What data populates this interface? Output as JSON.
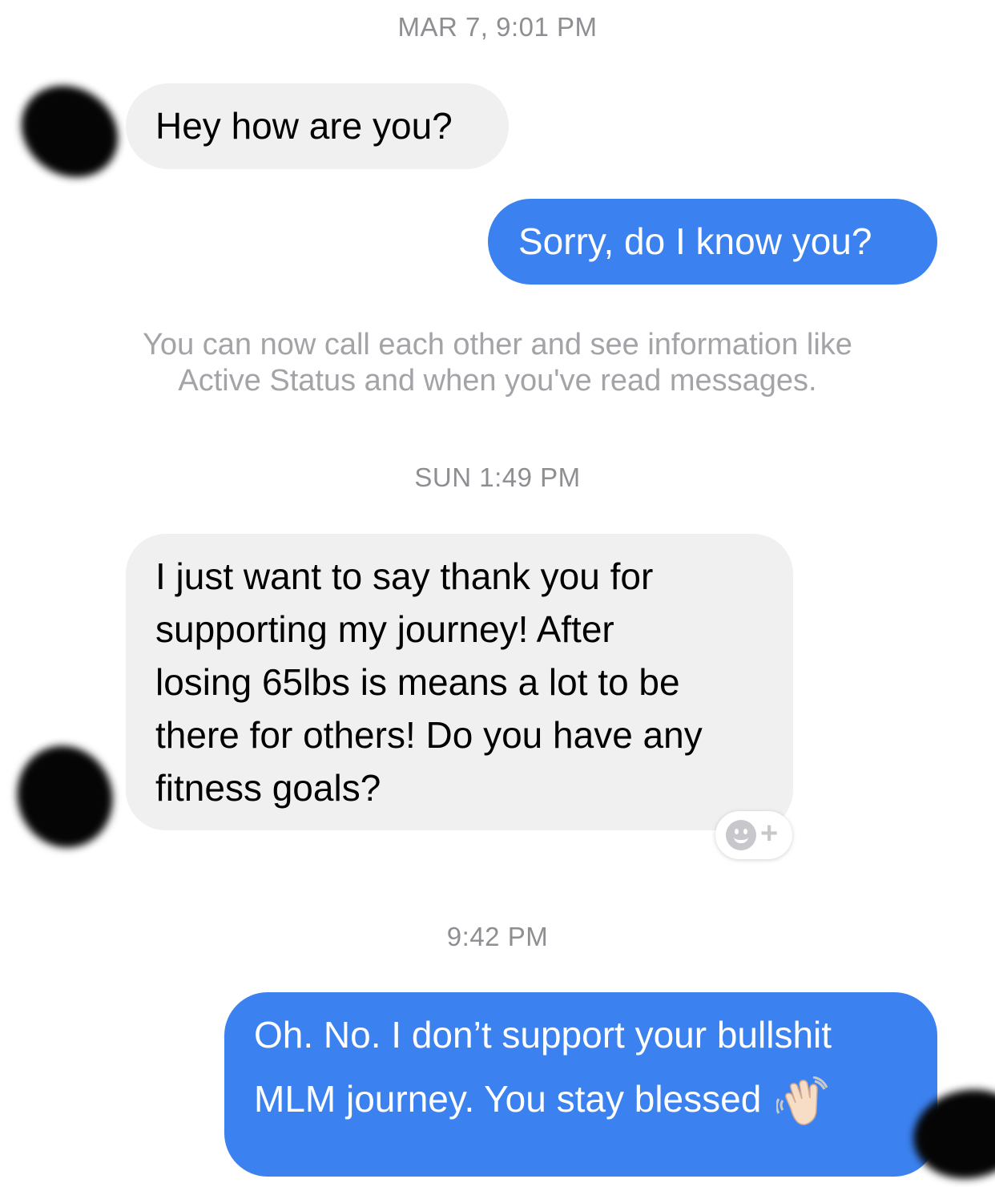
{
  "conversation": {
    "timestamps": {
      "first": "MAR 7, 9:01 PM",
      "second": "SUN 1:49 PM",
      "third": "9:42 PM"
    },
    "messages": [
      {
        "sender": "them",
        "text": "Hey how are you?"
      },
      {
        "sender": "me",
        "text": "Sorry, do I know you?"
      },
      {
        "sender": "them",
        "lines": [
          "I just want to say thank you for",
          "supporting my journey! After",
          "losing 65lbs is means a lot to be",
          "there for others! Do you have any",
          "fitness goals?"
        ]
      },
      {
        "sender": "me",
        "lines": [
          "Oh. No. I don’t support your bullshit",
          "MLM journey. You stay blessed"
        ]
      }
    ],
    "notice": {
      "line1": "You can now call each other and see information like",
      "line2": "Active Status and when you've read messages."
    }
  },
  "icons": {
    "reaction": "add-reaction-icon",
    "wave": "waving-hand-emoji-icon",
    "avatar": "contact-avatar-redacted"
  },
  "colors": {
    "incoming_bubble": "#f0f0f0",
    "outgoing_bubble": "#3b82f0",
    "timestamp": "#8e8e93",
    "notice": "#a3a3a8"
  }
}
